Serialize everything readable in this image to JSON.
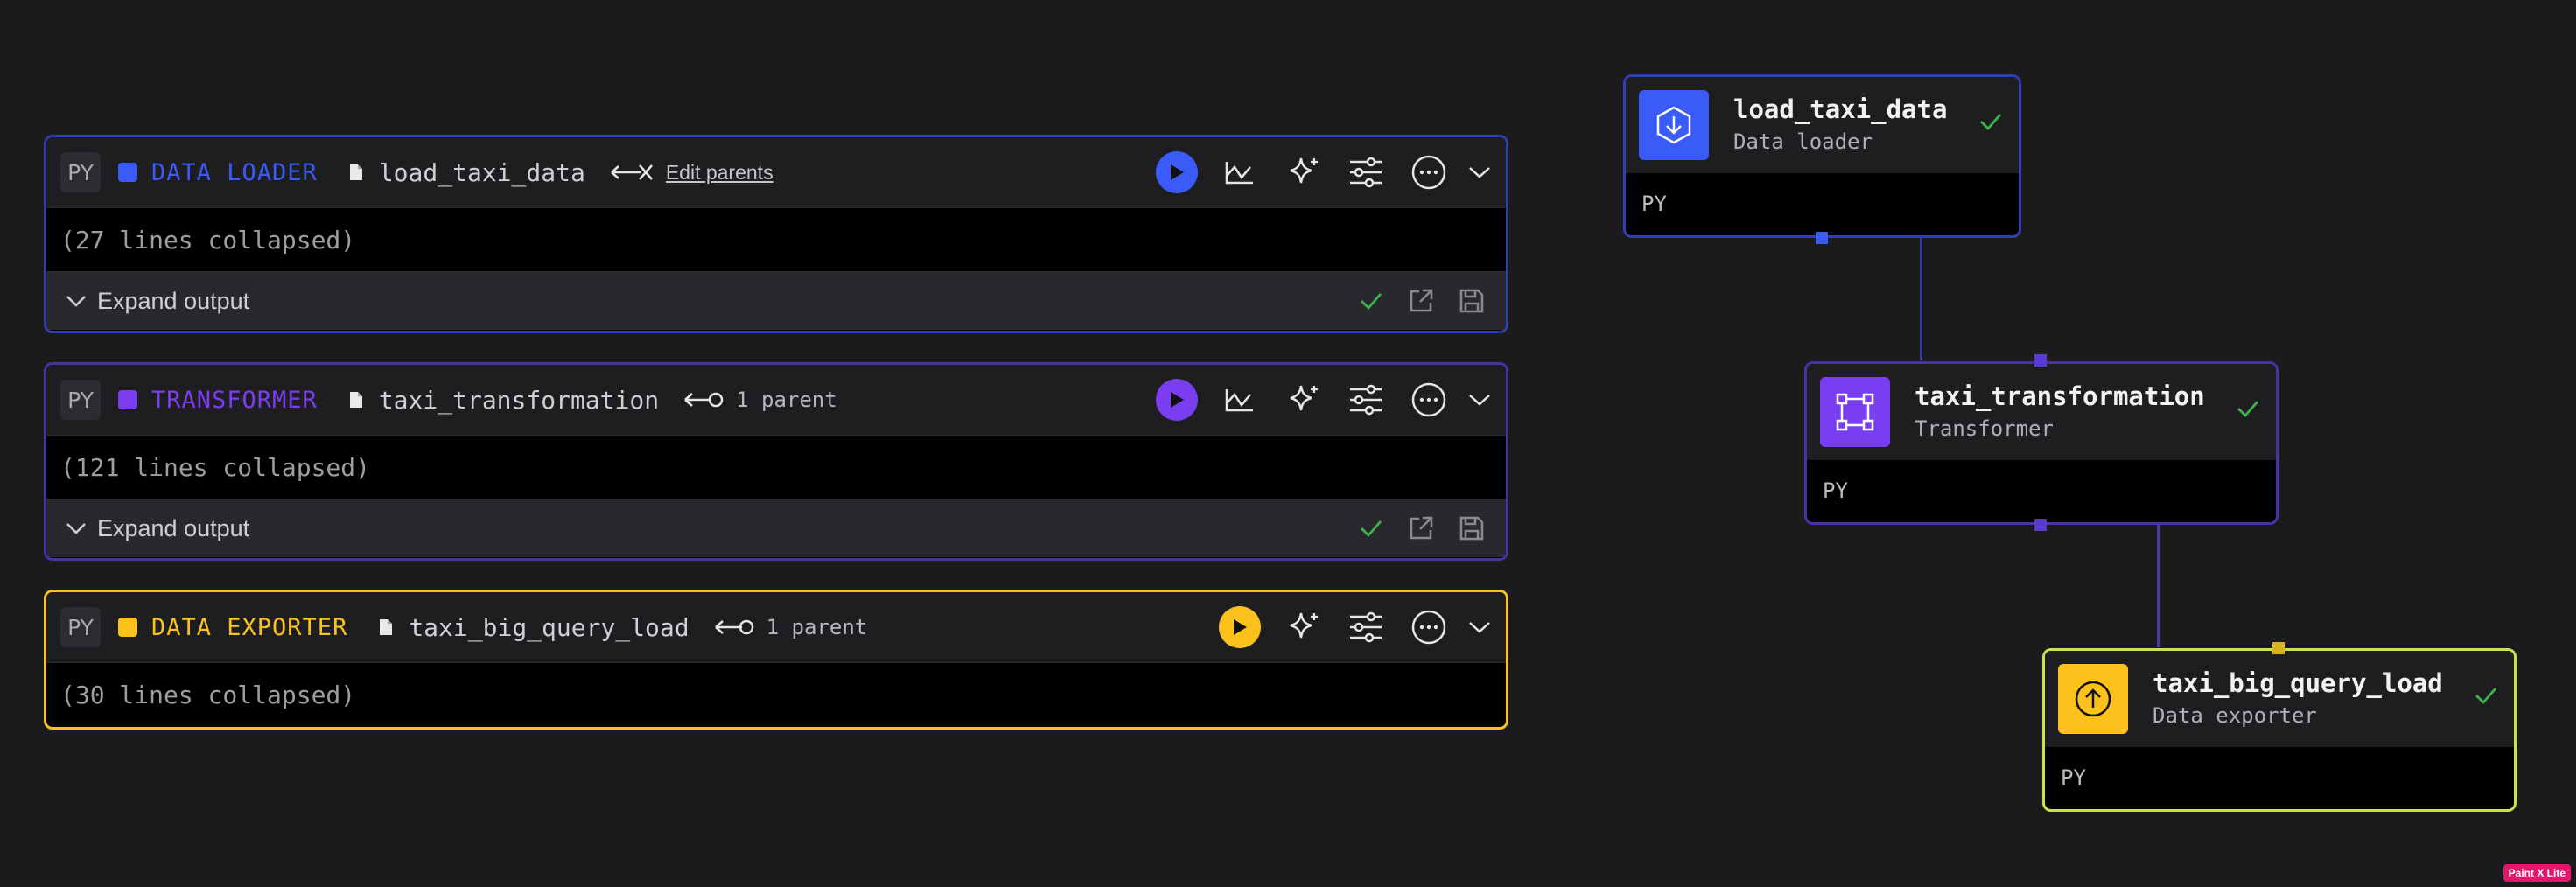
{
  "blocks": [
    {
      "lang": "PY",
      "type_label": "DATA LOADER",
      "name": "load_taxi_data",
      "parents_label": "Edit parents",
      "collapsed_text": "(27 lines collapsed)",
      "expand_label": "Expand output",
      "color": "#3b5bf6"
    },
    {
      "lang": "PY",
      "type_label": "TRANSFORMER",
      "name": "taxi_transformation",
      "parents_label": "1 parent",
      "collapsed_text": "(121 lines collapsed)",
      "expand_label": "Expand output",
      "color": "#7b3df0"
    },
    {
      "lang": "PY",
      "type_label": "DATA EXPORTER",
      "name": "taxi_big_query_load",
      "parents_label": "1 parent",
      "collapsed_text": "(30 lines collapsed)",
      "color": "#fcc21b"
    }
  ],
  "graph": {
    "nodes": [
      {
        "title": "load_taxi_data",
        "subtitle": "Data loader",
        "lang": "PY",
        "color": "#3b5bf6",
        "icon": "download-icon"
      },
      {
        "title": "taxi_transformation",
        "subtitle": "Transformer",
        "lang": "PY",
        "color": "#7b3df0",
        "icon": "transform-icon"
      },
      {
        "title": "taxi_big_query_load",
        "subtitle": "Data exporter",
        "lang": "PY",
        "color": "#fcc21b",
        "icon": "upload-icon"
      }
    ]
  },
  "watermark": "Paint X Lite",
  "colors": {
    "success": "#3bb54a",
    "background": "#1b1b1e"
  }
}
